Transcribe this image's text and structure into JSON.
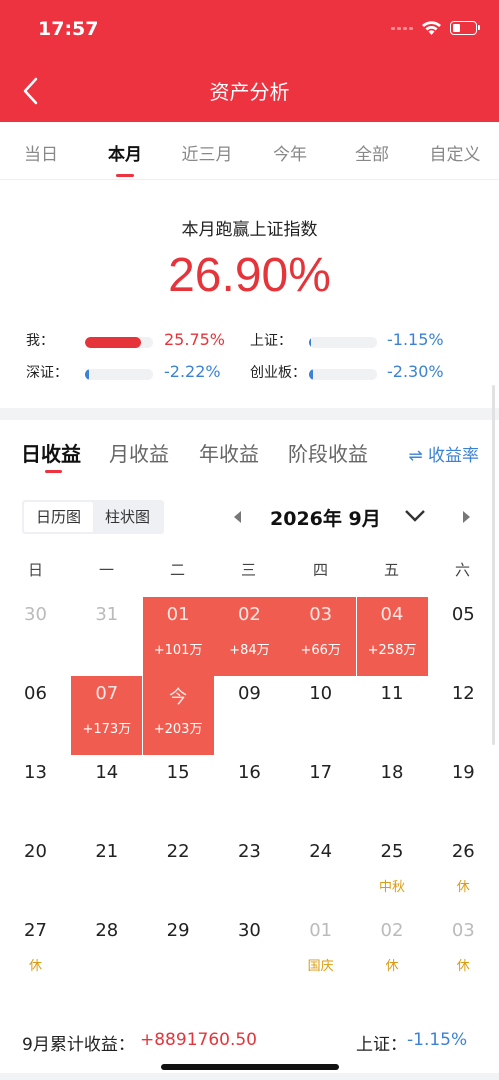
{
  "status": {
    "time": "17:57"
  },
  "header": {
    "title": "资产分析"
  },
  "periods": [
    "当日",
    "本月",
    "近三月",
    "今年",
    "全部",
    "自定义"
  ],
  "summary": {
    "title": "本月跑赢上证指数",
    "value": "26.90%",
    "metrics": [
      {
        "label": "我：",
        "value": "25.75%",
        "progress": 0.82,
        "color": "#e5353b"
      },
      {
        "label": "上证：",
        "value": "-1.15%",
        "progress": 0.03,
        "color": "#3b82d5"
      },
      {
        "label": "深证：",
        "value": "-2.22%",
        "progress": 0.06,
        "color": "#3b82d5"
      },
      {
        "label": "创业板：",
        "value": "-2.30%",
        "progress": 0.06,
        "color": "#3b82d5"
      }
    ]
  },
  "income_tabs": [
    "日收益",
    "月收益",
    "年收益",
    "阶段收益"
  ],
  "yield_rate": "⇌ 收益率",
  "view_modes": [
    "日历图",
    "柱状图"
  ],
  "calendar": {
    "month": "2026年 9月",
    "weekdays": [
      "日",
      "一",
      "二",
      "三",
      "四",
      "五",
      "六"
    ],
    "cells": [
      {
        "day": "30",
        "muted": true
      },
      {
        "day": "31",
        "muted": true
      },
      {
        "day": "01",
        "gain": "+101万"
      },
      {
        "day": "02",
        "gain": "+84万"
      },
      {
        "day": "03",
        "gain": "+66万"
      },
      {
        "day": "04",
        "gain": "+258万"
      },
      {
        "day": "05"
      },
      {
        "day": "06"
      },
      {
        "day": "07",
        "gain": "+173万"
      },
      {
        "day": "今",
        "gain": "+203万"
      },
      {
        "day": "09"
      },
      {
        "day": "10"
      },
      {
        "day": "11"
      },
      {
        "day": "12"
      },
      {
        "day": "13"
      },
      {
        "day": "14"
      },
      {
        "day": "15"
      },
      {
        "day": "16"
      },
      {
        "day": "17"
      },
      {
        "day": "18"
      },
      {
        "day": "19"
      },
      {
        "day": "20"
      },
      {
        "day": "21"
      },
      {
        "day": "22"
      },
      {
        "day": "23"
      },
      {
        "day": "24"
      },
      {
        "day": "25",
        "note": "中秋"
      },
      {
        "day": "26",
        "note": "休"
      },
      {
        "day": "27",
        "note": "休"
      },
      {
        "day": "28"
      },
      {
        "day": "29"
      },
      {
        "day": "30"
      },
      {
        "day": "01",
        "muted": true,
        "note": "国庆"
      },
      {
        "day": "02",
        "muted": true,
        "note": "休"
      },
      {
        "day": "03",
        "muted": true,
        "note": "休"
      }
    ]
  },
  "footer": {
    "cumulative_label": "9月累计收益：",
    "cumulative_value": "+8891760.50",
    "index_label": "上证：",
    "index_value": "-1.15%"
  }
}
